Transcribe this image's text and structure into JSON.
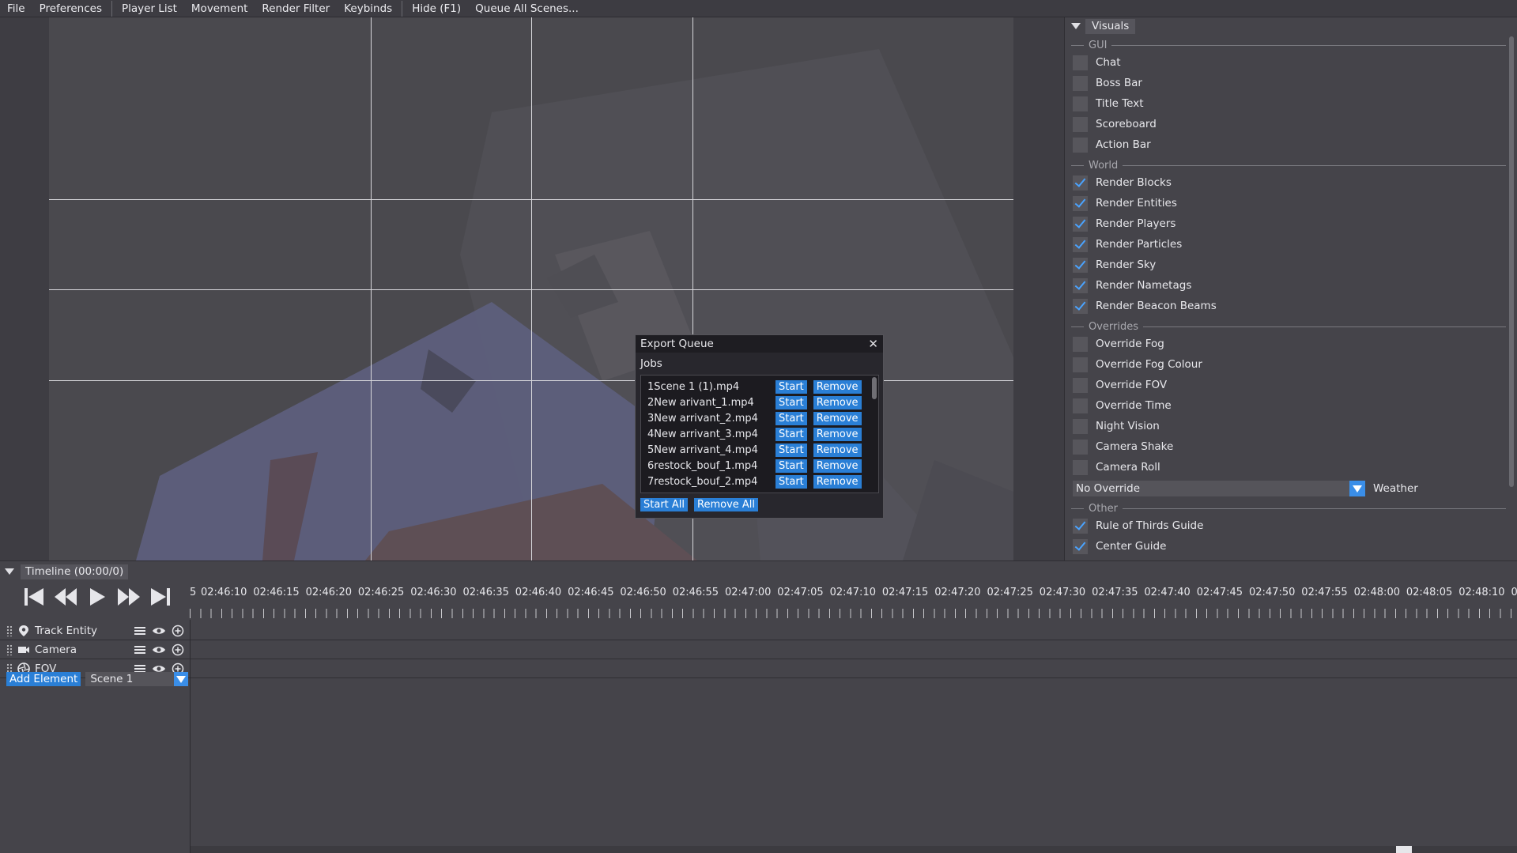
{
  "menu": [
    "File",
    "Preferences",
    "Player List",
    "Movement",
    "Render Filter",
    "Keybinds",
    "Hide (F1)",
    "Queue All Scenes..."
  ],
  "panel": {
    "title": "Visuals",
    "sections": {
      "gui": "GUI",
      "world": "World",
      "overrides": "Overrides",
      "other": "Other"
    },
    "gui_items": [
      {
        "label": "Chat",
        "checked": false
      },
      {
        "label": "Boss Bar",
        "checked": false
      },
      {
        "label": "Title Text",
        "checked": false
      },
      {
        "label": "Scoreboard",
        "checked": false
      },
      {
        "label": "Action Bar",
        "checked": false
      }
    ],
    "world_items": [
      {
        "label": "Render Blocks",
        "checked": true
      },
      {
        "label": "Render Entities",
        "checked": true
      },
      {
        "label": "Render Players",
        "checked": true
      },
      {
        "label": "Render Particles",
        "checked": true
      },
      {
        "label": "Render Sky",
        "checked": true
      },
      {
        "label": "Render Nametags",
        "checked": true
      },
      {
        "label": "Render Beacon Beams",
        "checked": true
      }
    ],
    "override_items": [
      {
        "label": "Override Fog",
        "checked": false
      },
      {
        "label": "Override Fog Colour",
        "checked": false
      },
      {
        "label": "Override FOV",
        "checked": false
      },
      {
        "label": "Override Time",
        "checked": false
      },
      {
        "label": "Night Vision",
        "checked": false
      },
      {
        "label": "Camera Shake",
        "checked": false
      },
      {
        "label": "Camera Roll",
        "checked": false
      }
    ],
    "weather": {
      "value": "No Override",
      "label": "Weather"
    },
    "other_items": [
      {
        "label": "Rule of Thirds Guide",
        "checked": true
      },
      {
        "label": "Center Guide",
        "checked": true
      }
    ]
  },
  "dialog": {
    "title": "Export Queue",
    "close": "✕",
    "jobs_label": "Jobs",
    "start_label": "Start",
    "remove_label": "Remove",
    "jobs": [
      "1Scene 1 (1).mp4",
      "2New arivant_1.mp4",
      "3New arrivant_2.mp4",
      "4New arrivant_3.mp4",
      "5New arrivant_4.mp4",
      "6restock_bouf_1.mp4",
      "7restock_bouf_2.mp4"
    ],
    "start_all": "Start All",
    "remove_all": "Remove All"
  },
  "timeline": {
    "title": "Timeline (00:00/0)",
    "ticks": [
      "5",
      "02:46:10",
      "02:46:15",
      "02:46:20",
      "02:46:25",
      "02:46:30",
      "02:46:35",
      "02:46:40",
      "02:46:45",
      "02:46:50",
      "02:46:55",
      "02:47:00",
      "02:47:05",
      "02:47:10",
      "02:47:15",
      "02:47:20",
      "02:47:25",
      "02:47:30",
      "02:47:35",
      "02:47:40",
      "02:47:45",
      "02:47:50",
      "02:47:55",
      "02:48:00",
      "02:48:05",
      "02:48:10",
      "0"
    ],
    "tracks": [
      {
        "name": "Track Entity",
        "icon": "map-pin-icon"
      },
      {
        "name": "Camera",
        "icon": "video-camera-icon"
      },
      {
        "name": "FOV",
        "icon": "aperture-icon"
      }
    ],
    "add_element": "Add Element",
    "scene": "Scene 1"
  },
  "colors": {
    "accent": "#2a7fd6",
    "check": "#4aa3ff"
  }
}
